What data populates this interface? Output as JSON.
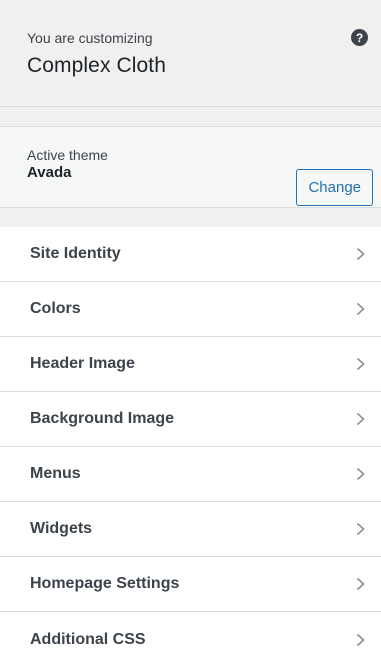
{
  "info": {
    "subtitle": "You are customizing",
    "site_title": "Complex Cloth",
    "help_icon": "question-circle-icon"
  },
  "theme": {
    "label": "Active theme",
    "name": "Avada",
    "change_label": "Change"
  },
  "sections": [
    {
      "label": "Site Identity"
    },
    {
      "label": "Colors"
    },
    {
      "label": "Header Image"
    },
    {
      "label": "Background Image"
    },
    {
      "label": "Menus"
    },
    {
      "label": "Widgets"
    },
    {
      "label": "Homepage Settings"
    },
    {
      "label": "Additional CSS"
    }
  ],
  "colors": {
    "accent": "#2271b1",
    "text": "#1d2327",
    "muted": "#3c434a",
    "background": "#f0f0f1"
  }
}
